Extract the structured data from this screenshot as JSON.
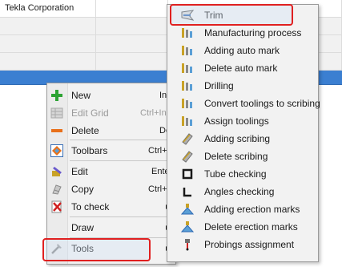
{
  "grid": {
    "first_cell": "Tekla Corporation"
  },
  "main_menu": {
    "items": [
      {
        "label": "New",
        "shortcut": "Ins",
        "icon": "plus-icon",
        "disabled": false
      },
      {
        "label": "Edit Grid",
        "shortcut": "Ctrl+Ins",
        "icon": "edit-grid-icon",
        "disabled": true
      },
      {
        "label": "Delete",
        "shortcut": "Del",
        "icon": "minus-icon",
        "disabled": false
      },
      {
        "label": "Toolbars",
        "shortcut": "Ctrl+B",
        "icon": "toolbars-icon",
        "disabled": false
      },
      {
        "label": "Edit",
        "shortcut": "Enter",
        "icon": "edit-icon",
        "disabled": false
      },
      {
        "label": "Copy",
        "shortcut": "Ctrl+C",
        "icon": "copy-icon",
        "disabled": false
      },
      {
        "label": "To check",
        "shortcut": "",
        "icon": "to-check-icon",
        "disabled": false
      },
      {
        "label": "Draw",
        "shortcut": "",
        "icon": "",
        "disabled": false
      },
      {
        "label": "Tools",
        "shortcut": "",
        "icon": "tools-icon",
        "disabled": false
      }
    ]
  },
  "sub_menu": {
    "items": [
      {
        "label": "Trim",
        "icon": "trim-icon"
      },
      {
        "label": "Manufacturing process",
        "icon": "manufacturing-icon"
      },
      {
        "label": "Adding auto mark",
        "icon": "auto-mark-icon"
      },
      {
        "label": "Delete auto mark",
        "icon": "delete-auto-mark-icon"
      },
      {
        "label": "Drilling",
        "icon": "drilling-icon"
      },
      {
        "label": "Convert toolings to scribing",
        "icon": "convert-toolings-icon"
      },
      {
        "label": "Assign toolings",
        "icon": "assign-toolings-icon"
      },
      {
        "label": "Adding scribing",
        "icon": "adding-scribing-icon"
      },
      {
        "label": "Delete scribing",
        "icon": "delete-scribing-icon"
      },
      {
        "label": "Tube checking",
        "icon": "tube-checking-icon"
      },
      {
        "label": "Angles checking",
        "icon": "angles-checking-icon"
      },
      {
        "label": "Adding erection marks",
        "icon": "erection-marks-icon"
      },
      {
        "label": "Delete erection marks",
        "icon": "delete-erection-marks-icon"
      },
      {
        "label": "Probings assignment",
        "icon": "probings-icon"
      }
    ]
  },
  "colors": {
    "highlight_border": "#e02020",
    "selected_row": "#3b7fd1",
    "menu_background": "#f2f2f2"
  }
}
